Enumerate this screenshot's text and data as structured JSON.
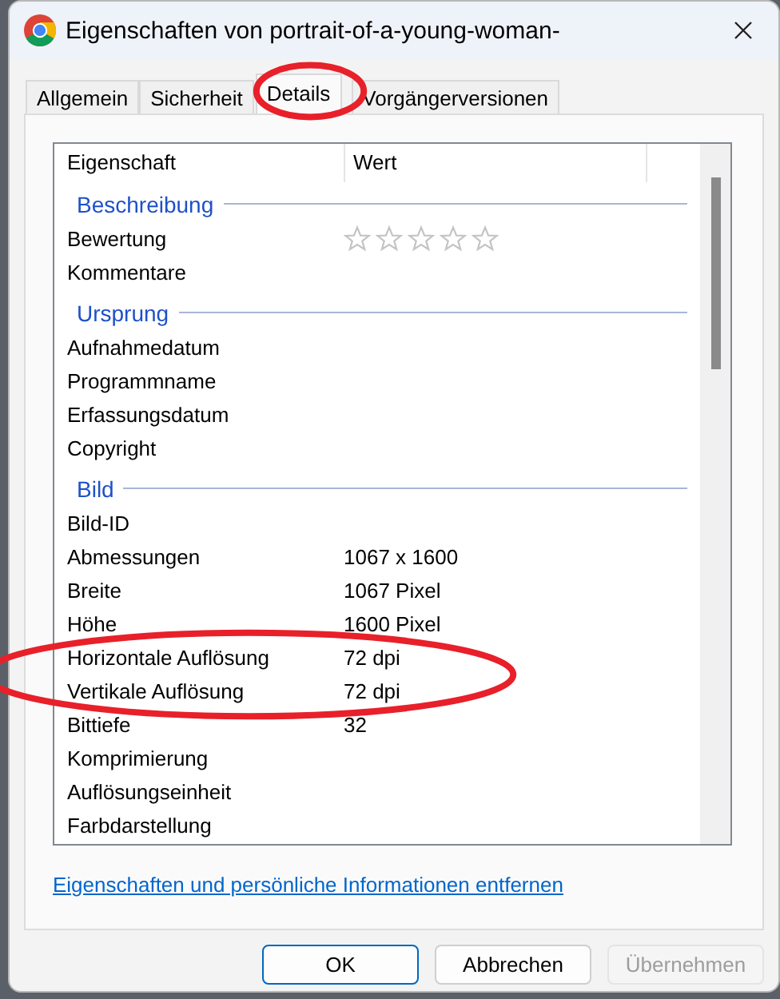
{
  "window": {
    "title": "Eigenschaften von portrait-of-a-young-woman-"
  },
  "tabs": [
    {
      "label": "Allgemein",
      "selected": false
    },
    {
      "label": "Sicherheit",
      "selected": false
    },
    {
      "label": "Details",
      "selected": true
    },
    {
      "label": "Vorgängerversionen",
      "selected": false
    }
  ],
  "table": {
    "columns": [
      "Eigenschaft",
      "Wert"
    ],
    "rows": [
      {
        "kind": "group",
        "label": "Beschreibung"
      },
      {
        "kind": "rating",
        "label": "Bewertung",
        "stars": 0
      },
      {
        "kind": "property",
        "label": "Kommentare"
      },
      {
        "kind": "group",
        "label": "Ursprung"
      },
      {
        "kind": "property",
        "label": "Aufnahmedatum"
      },
      {
        "kind": "property",
        "label": "Programmname"
      },
      {
        "kind": "property",
        "label": "Erfassungsdatum"
      },
      {
        "kind": "property",
        "label": "Copyright"
      },
      {
        "kind": "group",
        "label": "Bild"
      },
      {
        "kind": "property",
        "label": "Bild-ID"
      },
      {
        "kind": "property",
        "label": "Abmessungen",
        "value": "1067 x 1600"
      },
      {
        "kind": "property",
        "label": "Breite",
        "value": "1067 Pixel"
      },
      {
        "kind": "property",
        "label": "Höhe",
        "value": "1600 Pixel"
      },
      {
        "kind": "property",
        "label": "Horizontale Auflösung",
        "value": "72 dpi"
      },
      {
        "kind": "property",
        "label": "Vertikale Auflösung",
        "value": "72 dpi"
      },
      {
        "kind": "property",
        "label": "Bittiefe",
        "value": "32"
      },
      {
        "kind": "property",
        "label": "Komprimierung"
      },
      {
        "kind": "property",
        "label": "Auflösungseinheit"
      },
      {
        "kind": "property",
        "label": "Farbdarstellung"
      }
    ]
  },
  "link": "Eigenschaften und persönliche Informationen entfernen",
  "buttons": [
    {
      "label": "OK",
      "kind": "default",
      "disabled": false
    },
    {
      "label": "Abbrechen",
      "kind": "normal",
      "disabled": false
    },
    {
      "label": "Übernehmen",
      "kind": "normal",
      "disabled": true
    }
  ],
  "annotations": [
    {
      "kind": "ellipse",
      "color": "#e8202a"
    },
    {
      "kind": "ellipse",
      "color": "#e8202a"
    }
  ]
}
